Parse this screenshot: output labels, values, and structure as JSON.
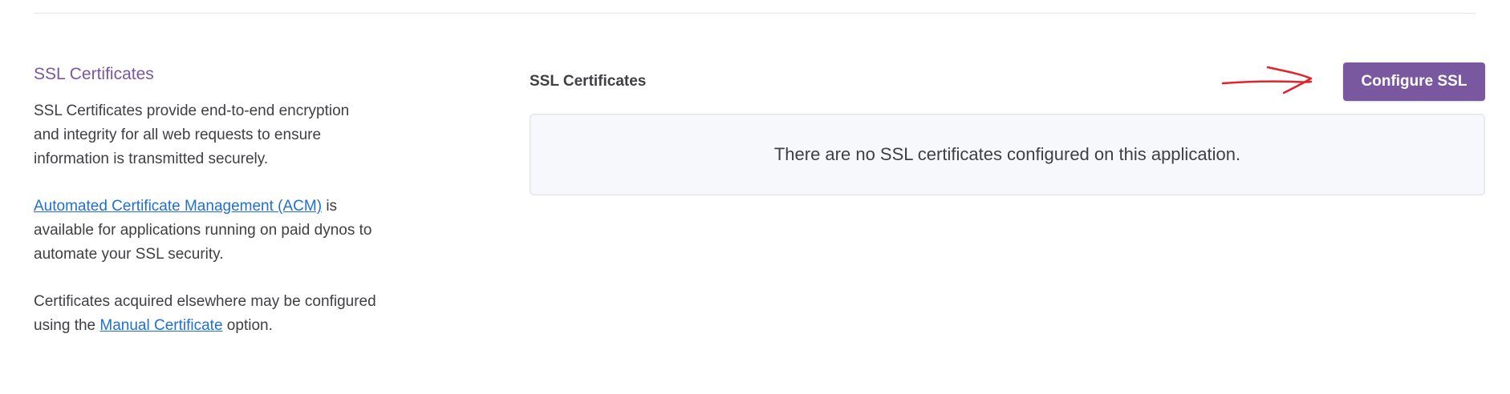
{
  "left_panel": {
    "title": "SSL Certificates",
    "description": "SSL Certificates provide end-to-end encryption and integrity for all web requests to ensure information is transmitted securely.",
    "acm_link": "Automated Certificate Management (ACM)",
    "acm_text": " is available for applications running on paid dynos to automate your SSL security.",
    "manual_prefix": "Certificates acquired elsewhere may be configured using the ",
    "manual_link": "Manual Certificate",
    "manual_suffix": " option."
  },
  "right_panel": {
    "title": "SSL Certificates",
    "configure_button": "Configure SSL",
    "empty_message": "There are no SSL certificates configured on this application."
  },
  "colors": {
    "accent": "#79589f",
    "link": "#1f6fd6",
    "annotation_arrow": "#e0242b"
  },
  "icons": {
    "annotation": "red-arrow-icon"
  }
}
